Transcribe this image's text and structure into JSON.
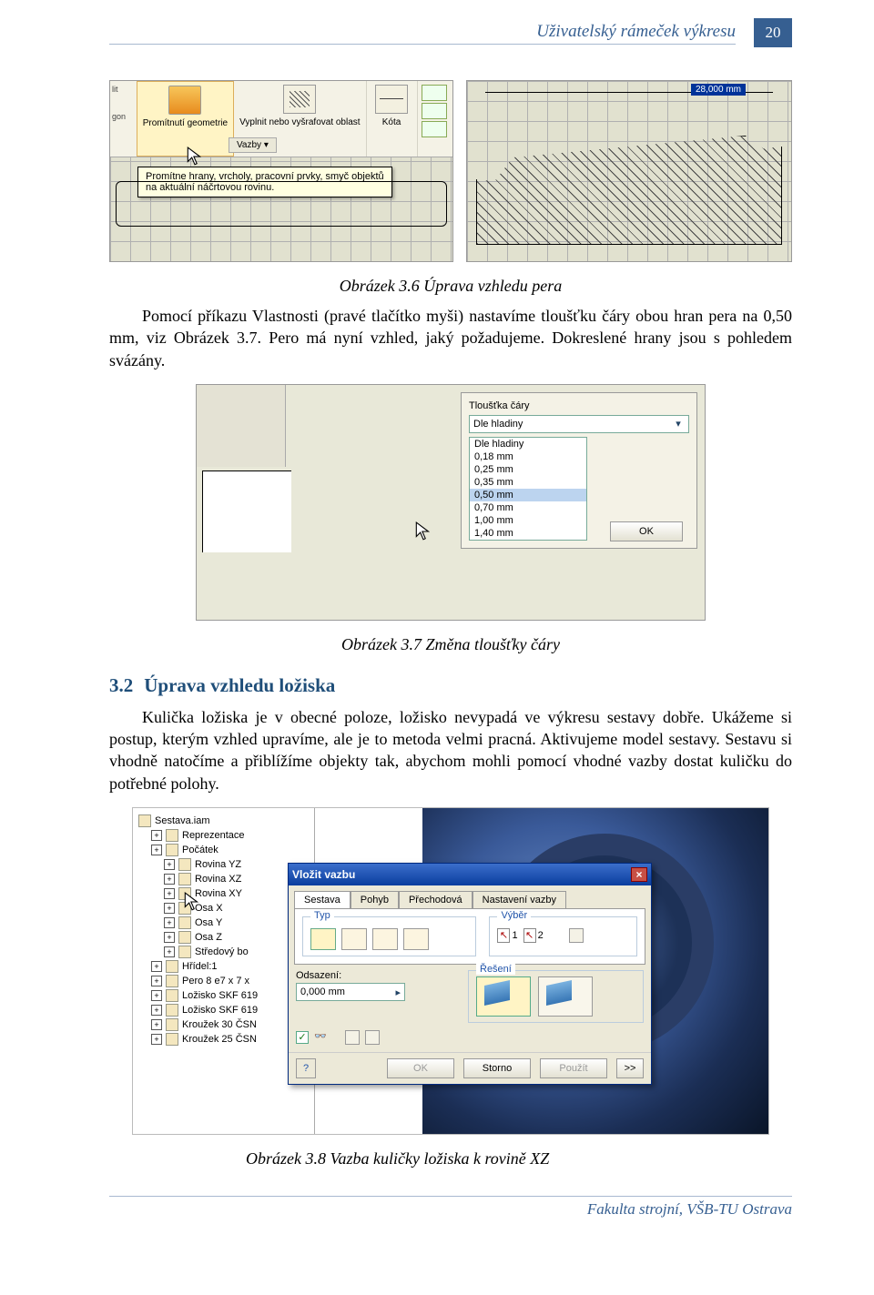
{
  "header": {
    "title": "Uživatelský rámeček výkresu",
    "page": "20"
  },
  "fig1": {
    "toolbar": {
      "split_frag": "lit",
      "gon_frag": "gon",
      "btn1": "Promítnutí geometrie",
      "btn2": "Vyplnit nebo vyšrafovat oblast",
      "btn3": "Kóta",
      "vazby": "Vazby ▾"
    },
    "tooltip": "Promítne hrany, vrcholy, pracovní prvky, smyč objektů na aktuální náčrtovou rovinu.",
    "dim_value": "28,000 mm"
  },
  "caption1": "Obrázek 3.6 Úprava vzhledu pera",
  "para1": "Pomocí příkazu Vlastnosti (pravé tlačítko myši) nastavíme tloušťku čáry obou hran pera na 0,50 mm, viz Obrázek 3.7. Pero má nyní vzhled, jaký požadujeme. Dokreslené hrany jsou s pohledem svázány.",
  "fig2": {
    "panel_label": "Tloušťka čáry",
    "current": "Dle hladiny",
    "options": [
      "Dle hladiny",
      "0,18 mm",
      "0,25 mm",
      "0,35 mm",
      "0,50 mm",
      "0,70 mm",
      "1,00 mm",
      "1,40 mm"
    ],
    "selected_index": 4,
    "ok": "OK"
  },
  "caption2": "Obrázek 3.7 Změna tloušťky čáry",
  "h2": {
    "num": "3.2",
    "text": "Úprava vzhledu ložiska"
  },
  "para2": "Kulička ložiska je v obecné poloze, ložisko nevypadá ve výkresu sestavy dobře. Ukážeme si postup, kterým vzhled upravíme, ale je to metoda velmi pracná. Aktivujeme model sestavy. Sestavu si vhodně natočíme a přiblížíme objekty tak, abychom mohli pomocí vhodné vazby dostat kuličku do potřebné polohy.",
  "tree": {
    "root": "Sestava.iam",
    "items": [
      "Reprezentace",
      "Počátek",
      "Rovina YZ",
      "Rovina XZ",
      "Rovina XY",
      "Osa X",
      "Osa Y",
      "Osa Z",
      "Středový bo",
      "Hřídel:1",
      "Pero 8 e7 x 7 x",
      "Ložisko SKF 619",
      "Ložisko SKF 619",
      "Kroužek 30 ČSN",
      "Kroužek 25 ČSN"
    ]
  },
  "dialog": {
    "title": "Vložit vazbu",
    "tabs": [
      "Sestava",
      "Pohyb",
      "Přechodová",
      "Nastavení vazby"
    ],
    "grp_typ": "Typ",
    "grp_vyber": "Výběr",
    "pick1": "1",
    "pick2": "2",
    "odsazeni_label": "Odsazení:",
    "odsazeni_value": "0,000 mm",
    "reseni_label": "Řešení",
    "btn_ok": "OK",
    "btn_storno": "Storno",
    "btn_pouzit": "Použít",
    "btn_expand": ">>"
  },
  "caption3": "Obrázek 3.8 Vazba kuličky ložiska k rovině XZ",
  "footer": "Fakulta strojní, VŠB-TU Ostrava"
}
